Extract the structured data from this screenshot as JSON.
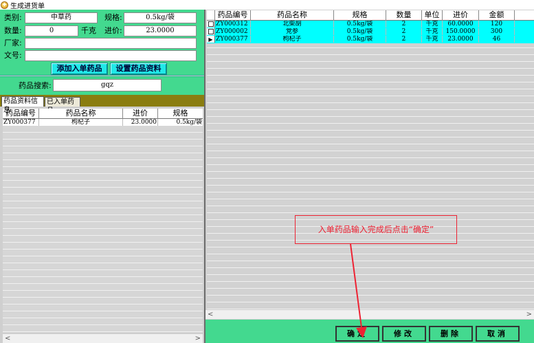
{
  "window": {
    "title": "生成进货单"
  },
  "form": {
    "category_label": "类别:",
    "category_value": "中草药",
    "spec_label": "规格:",
    "spec_value": "0.5kg/袋",
    "qty_label": "数量:",
    "qty_value": "0",
    "unit_label": "千克",
    "price_label": "进价:",
    "price_value": "23.0000",
    "maker_label": "厂家:",
    "maker_value": "",
    "doc_label": "文号:",
    "doc_value": "",
    "add_button": "添加入单药品",
    "setup_button": "设置药品资料",
    "search_label": "药品搜索:",
    "search_value": "gqz"
  },
  "tabs": [
    {
      "label": "药品资料信息",
      "active": true
    },
    {
      "label": "已入单药品",
      "active": false
    }
  ],
  "left_table": {
    "headers": [
      "药品编号",
      "药品名称",
      "进价",
      "规格"
    ],
    "rows": [
      [
        "ZY000377",
        "枸杞子",
        "23.0000",
        "0.5kg/袋"
      ]
    ]
  },
  "right_table": {
    "headers": [
      "药品编号",
      "药品名称",
      "规格",
      "数量",
      "单位",
      "进价",
      "金额"
    ],
    "rows": [
      [
        "ZY000312",
        "北柴胡",
        "0.5kg/袋",
        "2",
        "千克",
        "60.0000",
        "120"
      ],
      [
        "ZY000002",
        "党参",
        "0.5kg/袋",
        "2",
        "千克",
        "150.0000",
        "300"
      ],
      [
        "ZY000377",
        "枸杞子",
        "0.5kg/袋",
        "2",
        "千克",
        "23.0000",
        "46"
      ]
    ]
  },
  "callout": {
    "text": "入单药品输入完成后点击“确定”"
  },
  "actions": {
    "confirm": "确定",
    "modify": "修改",
    "delete": "删除",
    "cancel": "取消"
  },
  "scroll": {
    "left_arrow": "<",
    "right_arrow": ">"
  },
  "colors": {
    "accent_green": "#43d98f",
    "selected_row": "#00ffff",
    "callout_red": "#ee2233",
    "cyan_button": "#21e8e8"
  }
}
